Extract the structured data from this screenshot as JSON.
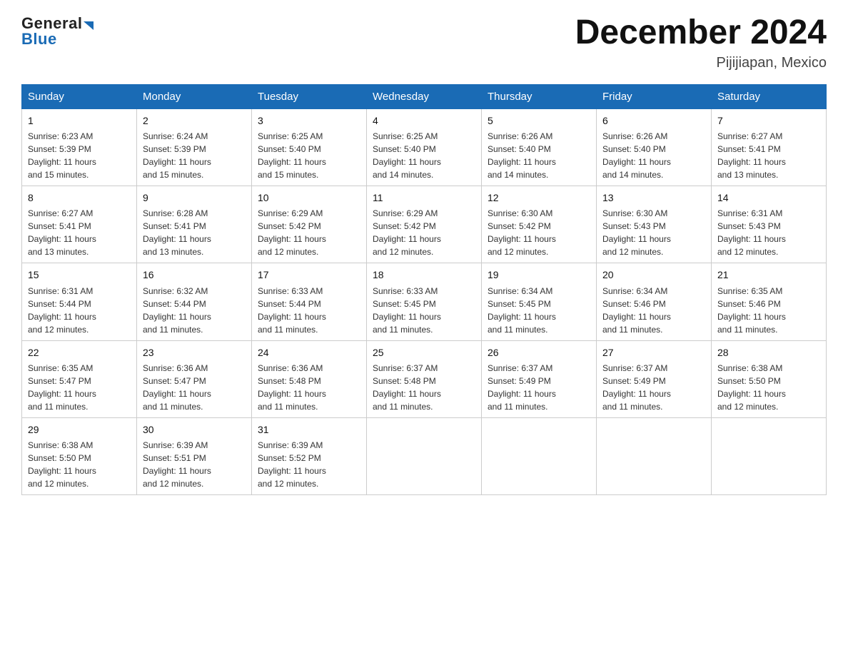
{
  "header": {
    "title": "December 2024",
    "location": "Pijijiapan, Mexico",
    "logo_general": "General",
    "logo_blue": "Blue"
  },
  "days_of_week": [
    "Sunday",
    "Monday",
    "Tuesday",
    "Wednesday",
    "Thursday",
    "Friday",
    "Saturday"
  ],
  "weeks": [
    [
      {
        "day": "1",
        "sunrise": "6:23 AM",
        "sunset": "5:39 PM",
        "daylight": "11 hours and 15 minutes."
      },
      {
        "day": "2",
        "sunrise": "6:24 AM",
        "sunset": "5:39 PM",
        "daylight": "11 hours and 15 minutes."
      },
      {
        "day": "3",
        "sunrise": "6:25 AM",
        "sunset": "5:40 PM",
        "daylight": "11 hours and 15 minutes."
      },
      {
        "day": "4",
        "sunrise": "6:25 AM",
        "sunset": "5:40 PM",
        "daylight": "11 hours and 14 minutes."
      },
      {
        "day": "5",
        "sunrise": "6:26 AM",
        "sunset": "5:40 PM",
        "daylight": "11 hours and 14 minutes."
      },
      {
        "day": "6",
        "sunrise": "6:26 AM",
        "sunset": "5:40 PM",
        "daylight": "11 hours and 14 minutes."
      },
      {
        "day": "7",
        "sunrise": "6:27 AM",
        "sunset": "5:41 PM",
        "daylight": "11 hours and 13 minutes."
      }
    ],
    [
      {
        "day": "8",
        "sunrise": "6:27 AM",
        "sunset": "5:41 PM",
        "daylight": "11 hours and 13 minutes."
      },
      {
        "day": "9",
        "sunrise": "6:28 AM",
        "sunset": "5:41 PM",
        "daylight": "11 hours and 13 minutes."
      },
      {
        "day": "10",
        "sunrise": "6:29 AM",
        "sunset": "5:42 PM",
        "daylight": "11 hours and 12 minutes."
      },
      {
        "day": "11",
        "sunrise": "6:29 AM",
        "sunset": "5:42 PM",
        "daylight": "11 hours and 12 minutes."
      },
      {
        "day": "12",
        "sunrise": "6:30 AM",
        "sunset": "5:42 PM",
        "daylight": "11 hours and 12 minutes."
      },
      {
        "day": "13",
        "sunrise": "6:30 AM",
        "sunset": "5:43 PM",
        "daylight": "11 hours and 12 minutes."
      },
      {
        "day": "14",
        "sunrise": "6:31 AM",
        "sunset": "5:43 PM",
        "daylight": "11 hours and 12 minutes."
      }
    ],
    [
      {
        "day": "15",
        "sunrise": "6:31 AM",
        "sunset": "5:44 PM",
        "daylight": "11 hours and 12 minutes."
      },
      {
        "day": "16",
        "sunrise": "6:32 AM",
        "sunset": "5:44 PM",
        "daylight": "11 hours and 11 minutes."
      },
      {
        "day": "17",
        "sunrise": "6:33 AM",
        "sunset": "5:44 PM",
        "daylight": "11 hours and 11 minutes."
      },
      {
        "day": "18",
        "sunrise": "6:33 AM",
        "sunset": "5:45 PM",
        "daylight": "11 hours and 11 minutes."
      },
      {
        "day": "19",
        "sunrise": "6:34 AM",
        "sunset": "5:45 PM",
        "daylight": "11 hours and 11 minutes."
      },
      {
        "day": "20",
        "sunrise": "6:34 AM",
        "sunset": "5:46 PM",
        "daylight": "11 hours and 11 minutes."
      },
      {
        "day": "21",
        "sunrise": "6:35 AM",
        "sunset": "5:46 PM",
        "daylight": "11 hours and 11 minutes."
      }
    ],
    [
      {
        "day": "22",
        "sunrise": "6:35 AM",
        "sunset": "5:47 PM",
        "daylight": "11 hours and 11 minutes."
      },
      {
        "day": "23",
        "sunrise": "6:36 AM",
        "sunset": "5:47 PM",
        "daylight": "11 hours and 11 minutes."
      },
      {
        "day": "24",
        "sunrise": "6:36 AM",
        "sunset": "5:48 PM",
        "daylight": "11 hours and 11 minutes."
      },
      {
        "day": "25",
        "sunrise": "6:37 AM",
        "sunset": "5:48 PM",
        "daylight": "11 hours and 11 minutes."
      },
      {
        "day": "26",
        "sunrise": "6:37 AM",
        "sunset": "5:49 PM",
        "daylight": "11 hours and 11 minutes."
      },
      {
        "day": "27",
        "sunrise": "6:37 AM",
        "sunset": "5:49 PM",
        "daylight": "11 hours and 11 minutes."
      },
      {
        "day": "28",
        "sunrise": "6:38 AM",
        "sunset": "5:50 PM",
        "daylight": "11 hours and 12 minutes."
      }
    ],
    [
      {
        "day": "29",
        "sunrise": "6:38 AM",
        "sunset": "5:50 PM",
        "daylight": "11 hours and 12 minutes."
      },
      {
        "day": "30",
        "sunrise": "6:39 AM",
        "sunset": "5:51 PM",
        "daylight": "11 hours and 12 minutes."
      },
      {
        "day": "31",
        "sunrise": "6:39 AM",
        "sunset": "5:52 PM",
        "daylight": "11 hours and 12 minutes."
      },
      null,
      null,
      null,
      null
    ]
  ],
  "labels": {
    "sunrise": "Sunrise:",
    "sunset": "Sunset:",
    "daylight": "Daylight:"
  }
}
